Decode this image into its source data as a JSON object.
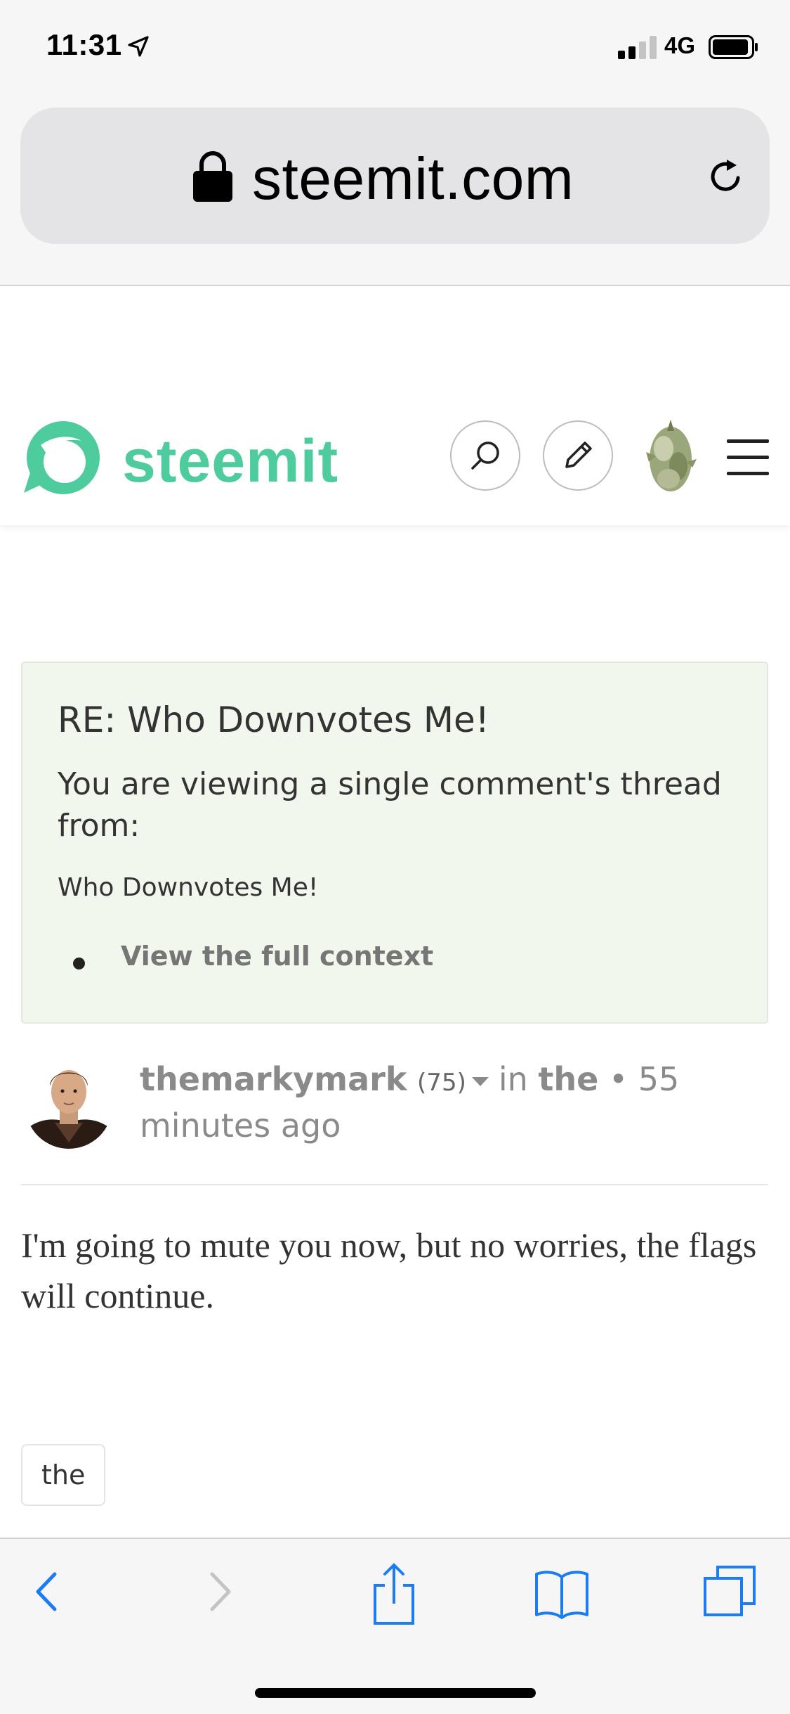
{
  "status_bar": {
    "time": "11:31",
    "network": "4G",
    "signal_bars_filled": 2,
    "signal_bars_total": 4,
    "battery_level": 0.85
  },
  "browser": {
    "url": "steemit.com",
    "lock_icon": "lock-icon",
    "reload_icon": "reload-icon",
    "toolbar_icons": [
      "back-icon",
      "forward-icon",
      "share-icon",
      "bookmarks-icon",
      "tabs-icon"
    ]
  },
  "site_header": {
    "logo_text": "steemit",
    "brand_color": "#4fcc9e",
    "icons": [
      "search-icon",
      "pencil-icon",
      "avatar",
      "hamburger-icon"
    ]
  },
  "context": {
    "title": "RE: Who Downvotes Me!",
    "subtitle": "You are viewing a single comment's thread from:",
    "parent_title": "Who Downvotes Me!",
    "link_text": "View the full context"
  },
  "comment": {
    "author": "themarkymark",
    "reputation": "(75)",
    "in_label": "in",
    "community": "the",
    "separator": "•",
    "time_ago": "55 minutes ago",
    "body": "I'm going to mute you now, but no worries, the flags will continue.",
    "tag": "the"
  }
}
